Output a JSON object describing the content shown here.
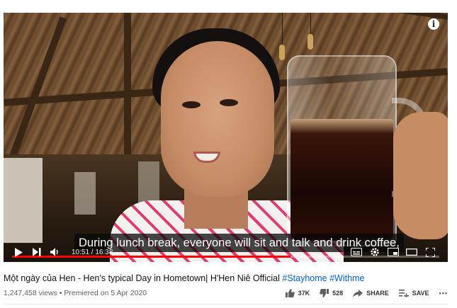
{
  "player": {
    "caption": "During lunch break, everyone will sit and talk and drink coffee,",
    "current_time": "10:51",
    "duration": "16:38",
    "time_display": "10:51 / 16:38",
    "progress_fraction": 0.652,
    "info_label": "i"
  },
  "video": {
    "title_main": "Một ngày của Hen - Hen's typical Day in Hometown| H'Hen Niê Official",
    "hashtag_1": "#Stayhome",
    "hashtag_2": "#Withme",
    "views_line": "1,247,458 views • Premiered on 5 Apr 2020"
  },
  "actions": {
    "likes": "37K",
    "dislikes": "528",
    "share_label": "SHARE",
    "save_label": "SAVE",
    "more_label": "•••"
  },
  "colors": {
    "progress": "#ff0000",
    "hashtag": "#065fd4"
  }
}
